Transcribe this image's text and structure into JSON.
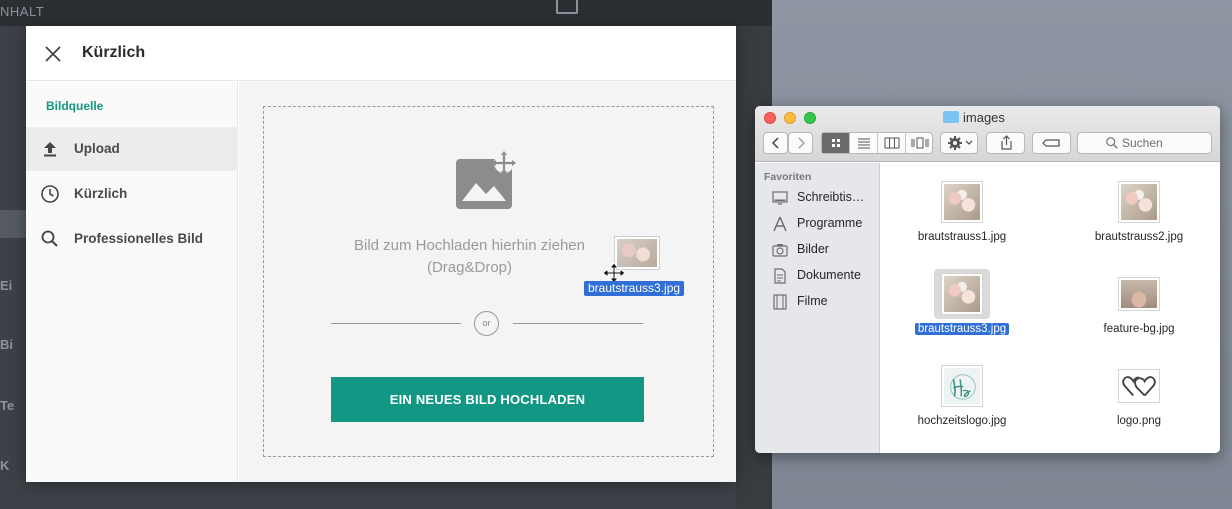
{
  "background_app": {
    "header_text": "NHALT",
    "sidebar_fragments": [
      "Ei",
      "Bi",
      "Te",
      "K"
    ]
  },
  "modal": {
    "title": "Kürzlich",
    "sidebar": {
      "heading": "Bildquelle",
      "items": [
        {
          "label": "Upload",
          "icon": "upload-icon",
          "active": true
        },
        {
          "label": "Kürzlich",
          "icon": "clock-icon",
          "active": false
        },
        {
          "label": "Professionelles Bild",
          "icon": "search-icon",
          "active": false
        }
      ]
    },
    "dropzone": {
      "text_line1": "Bild zum Hochladen hierhin ziehen",
      "text_line2": "(Drag&Drop)",
      "or_label": "or",
      "upload_button_label": "EIN NEUES BILD HOCHLADEN"
    },
    "drag_ghost": {
      "filename": "brautstrauss3.jpg"
    }
  },
  "finder": {
    "title": "images",
    "search_placeholder": "Suchen",
    "favorites_heading": "Favoriten",
    "favorites": [
      {
        "label": "Schreibtis…",
        "icon": "desktop-icon"
      },
      {
        "label": "Programme",
        "icon": "applications-icon"
      },
      {
        "label": "Bilder",
        "icon": "camera-icon"
      },
      {
        "label": "Dokumente",
        "icon": "documents-icon"
      },
      {
        "label": "Filme",
        "icon": "film-icon"
      }
    ],
    "files": [
      {
        "name": "brautstrauss1.jpg",
        "selected": false
      },
      {
        "name": "brautstrauss2.jpg",
        "selected": false
      },
      {
        "name": "brautstrauss3.jpg",
        "selected": true
      },
      {
        "name": "feature-bg.jpg",
        "selected": false
      },
      {
        "name": "hochzeitslogo.jpg",
        "selected": false
      },
      {
        "name": "logo.png",
        "selected": false
      }
    ]
  },
  "colors": {
    "accent_teal": "#139785",
    "selection_blue": "#2f6fd6"
  }
}
